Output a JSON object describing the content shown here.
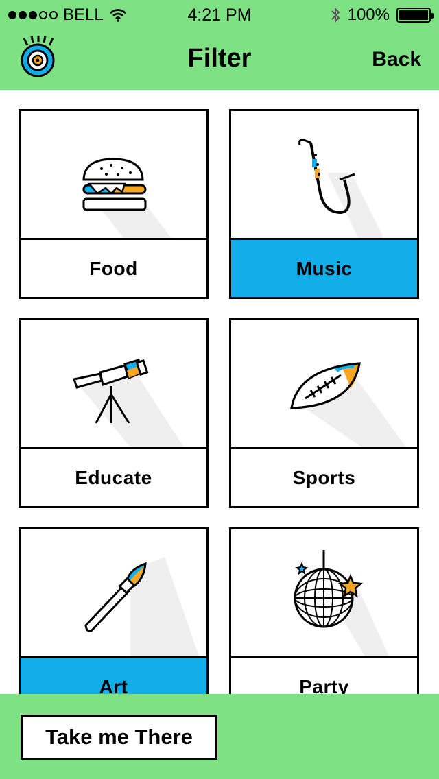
{
  "status": {
    "carrier": "BELL",
    "time": "4:21 PM",
    "battery": "100%"
  },
  "nav": {
    "title": "Filter",
    "back_label": "Back"
  },
  "categories": [
    {
      "label": "Food",
      "icon": "burger-icon",
      "selected": false
    },
    {
      "label": "Music",
      "icon": "saxophone-icon",
      "selected": true
    },
    {
      "label": "Educate",
      "icon": "telescope-icon",
      "selected": false
    },
    {
      "label": "Sports",
      "icon": "football-icon",
      "selected": false
    },
    {
      "label": "Art",
      "icon": "paintbrush-icon",
      "selected": true
    },
    {
      "label": "Party",
      "icon": "disco-ball-icon",
      "selected": false
    }
  ],
  "cta": {
    "label": "Take me There"
  },
  "colors": {
    "green": "#7ee184",
    "accent_blue": "#12aeea",
    "accent_orange": "#f5a623"
  }
}
